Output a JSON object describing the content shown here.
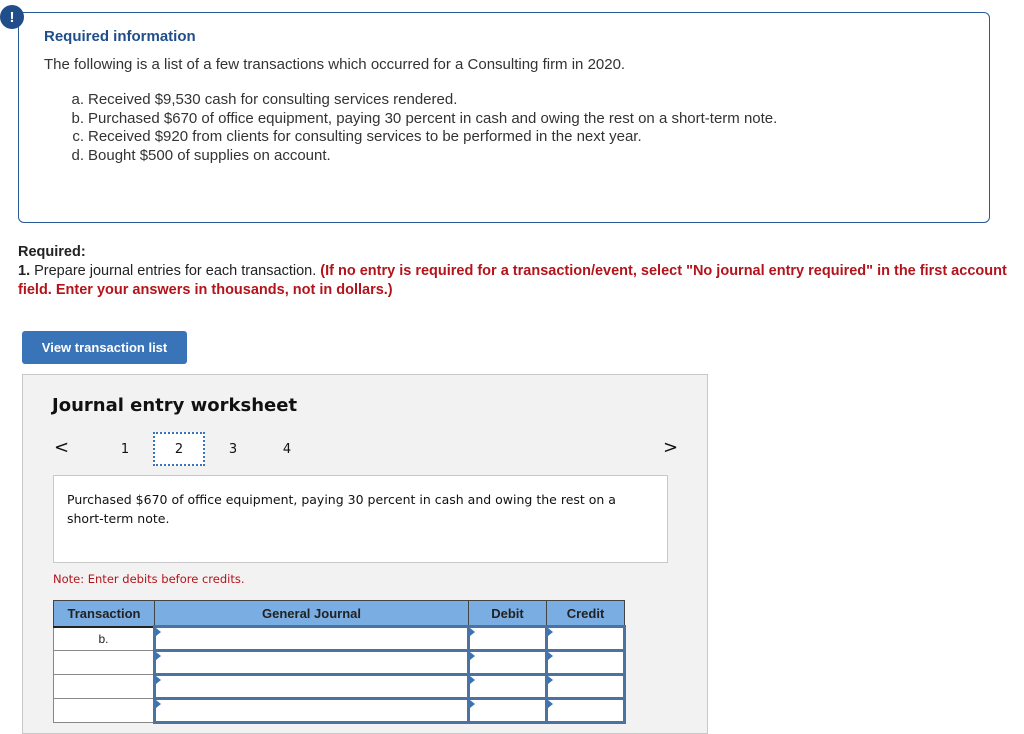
{
  "alert": {
    "icon": "exclamation-icon",
    "icon_glyph": "!",
    "title": "Required information",
    "intro": "The following is a list of a few transactions which occurred for a Consulting firm in 2020.",
    "transactions": [
      {
        "label": "a.",
        "text": "Received $9,530 cash for consulting services rendered."
      },
      {
        "label": "b.",
        "text": "Purchased $670 of office equipment, paying 30 percent in cash and owing the rest on a short-term note."
      },
      {
        "label": "c.",
        "text": "Received $920 from clients for consulting services to be performed in the next year."
      },
      {
        "label": "d.",
        "text": "Bought $500 of supplies on account."
      }
    ]
  },
  "required": {
    "heading": "Required:",
    "number": "1.",
    "instruction": " Prepare journal entries for each transaction. ",
    "emphasis": "(If no entry is required for a transaction/event, select \"No journal entry required\" in the first account field. Enter your answers in thousands, not in dollars.)"
  },
  "view_button": {
    "label": "View transaction list"
  },
  "worksheet": {
    "title": "Journal entry worksheet",
    "prev_glyph": "<",
    "next_glyph": ">",
    "pages": [
      "1",
      "2",
      "3",
      "4"
    ],
    "active_page": "2",
    "description": "Purchased $670 of office equipment, paying 30 percent in cash and owing the rest on a short-term note.",
    "note": "Note: Enter debits before credits.",
    "table": {
      "headers": [
        "Transaction",
        "General Journal",
        "Debit",
        "Credit"
      ],
      "rows": [
        {
          "transaction": "b.",
          "account": "",
          "debit": "",
          "credit": ""
        },
        {
          "transaction": "",
          "account": "",
          "debit": "",
          "credit": ""
        },
        {
          "transaction": "",
          "account": "",
          "debit": "",
          "credit": ""
        },
        {
          "transaction": "",
          "account": "",
          "debit": "",
          "credit": ""
        }
      ]
    }
  },
  "colors": {
    "alert_blue": "#1f4e8a",
    "instruction_red": "#b3141b",
    "button_blue": "#3a74b8",
    "table_header_blue": "#7aaee3"
  }
}
